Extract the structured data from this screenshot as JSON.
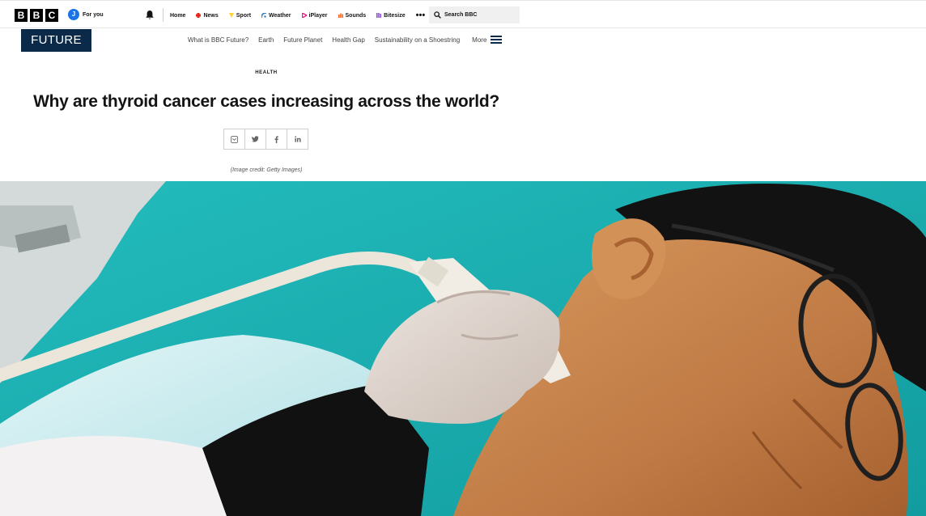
{
  "global_nav": {
    "logo_letters": [
      "B",
      "B",
      "C"
    ],
    "account": {
      "initial": "J",
      "label": "For you"
    },
    "items": [
      {
        "label": "Home",
        "icon": "none"
      },
      {
        "label": "News",
        "icon": "news-icon",
        "color": "#e3281b"
      },
      {
        "label": "Sport",
        "icon": "sport-icon",
        "color": "#ffd230"
      },
      {
        "label": "Weather",
        "icon": "weather-icon",
        "color": "#2e80c4"
      },
      {
        "label": "iPlayer",
        "icon": "iplayer-icon",
        "color": "#f0168e"
      },
      {
        "label": "Sounds",
        "icon": "sounds-icon",
        "color": "#ff5a12"
      },
      {
        "label": "Bitesize",
        "icon": "bitesize-icon",
        "color": "#8a44d9"
      }
    ],
    "more": "•••",
    "search_label": "Search BBC"
  },
  "future_header": {
    "logo": "FUTURE",
    "nav": [
      "What is BBC Future?",
      "Earth",
      "Future Planet",
      "Health Gap",
      "Sustainability on a Shoestring"
    ],
    "more_label": "More"
  },
  "article": {
    "section": "HEALTH",
    "headline": "Why are thyroid cancer cases increasing across the world?",
    "share_buttons": [
      "email-icon",
      "twitter-icon",
      "facebook-icon",
      "linkedin-icon"
    ],
    "image_credit": "(Image credit: Getty Images)"
  },
  "colors": {
    "future_navy": "#0b2a4a",
    "hero_teal": "#1bb3b5"
  }
}
